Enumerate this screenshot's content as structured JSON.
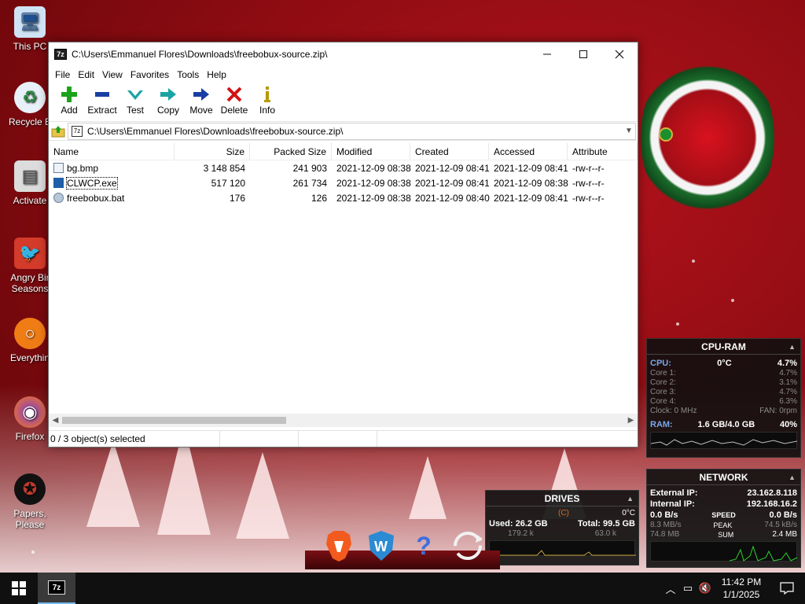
{
  "desktop": {
    "icons": [
      {
        "label": "This PC"
      },
      {
        "label": "Recycle B"
      },
      {
        "label": "Activate"
      },
      {
        "label": "Angry Bir Seasons"
      },
      {
        "label": "Everythin"
      },
      {
        "label": "Firefox"
      },
      {
        "label": "Papers, Please"
      }
    ]
  },
  "window": {
    "title": "C:\\Users\\Emmanuel Flores\\Downloads\\freebobux-source.zip\\",
    "app_icon": "7z",
    "menu": [
      "File",
      "Edit",
      "View",
      "Favorites",
      "Tools",
      "Help"
    ],
    "toolbar": [
      {
        "label": "Add",
        "icon": "plus-icon",
        "color": "#1aa31a"
      },
      {
        "label": "Extract",
        "icon": "minus-icon",
        "color": "#1a3fa3"
      },
      {
        "label": "Test",
        "icon": "check-icon",
        "color": "#1aa3a3"
      },
      {
        "label": "Copy",
        "icon": "arrow-right-icon",
        "color": "#1aa3a3"
      },
      {
        "label": "Move",
        "icon": "arrow-right-icon",
        "color": "#1a3fa3"
      },
      {
        "label": "Delete",
        "icon": "x-icon",
        "color": "#d01414"
      },
      {
        "label": "Info",
        "icon": "info-icon",
        "color": "#b59a00"
      }
    ],
    "address": "C:\\Users\\Emmanuel Flores\\Downloads\\freebobux-source.zip\\",
    "columns": [
      "Name",
      "Size",
      "Packed Size",
      "Modified",
      "Created",
      "Accessed",
      "Attribute"
    ],
    "files": [
      {
        "name": "bg.bmp",
        "size": "3 148 854",
        "packed": "241 903",
        "modified": "2021-12-09 08:38",
        "created": "2021-12-09 08:41",
        "accessed": "2021-12-09 08:41",
        "attr": "-rw-r--r-"
      },
      {
        "name": "CLWCP.exe",
        "size": "517 120",
        "packed": "261 734",
        "modified": "2021-12-09 08:38",
        "created": "2021-12-09 08:41",
        "accessed": "2021-12-09 08:38",
        "attr": "-rw-r--r-"
      },
      {
        "name": "freebobux.bat",
        "size": "176",
        "packed": "126",
        "modified": "2021-12-09 08:38",
        "created": "2021-12-09 08:40",
        "accessed": "2021-12-09 08:41",
        "attr": "-rw-r--r-"
      }
    ],
    "status": "0 / 3 object(s) selected"
  },
  "cpu_gadget": {
    "title": "CPU-RAM",
    "cpu_label": "CPU:",
    "cpu_temp": "0°C",
    "cpu_pct": "4.7%",
    "cores": [
      {
        "label": "Core 1:",
        "value": "4.7%"
      },
      {
        "label": "Core 2:",
        "value": "3.1%"
      },
      {
        "label": "Core 3:",
        "value": "4.7%"
      },
      {
        "label": "Core 4:",
        "value": "6.3%"
      }
    ],
    "clock": "Clock: 0 MHz",
    "fan": "FAN: 0rpm",
    "ram_label": "RAM:",
    "ram_value": "1.6 GB/4.0 GB",
    "ram_pct": "40%"
  },
  "network_gadget": {
    "title": "NETWORK",
    "ext_label": "External IP:",
    "ext_ip": "23.162.8.118",
    "int_label": "Internal IP:",
    "int_ip": "192.168.16.2",
    "speed_left": "0.0 B/s",
    "speed_label": "SPEED",
    "speed_right": "0.0 B/s",
    "peak_left": "8.3 MB/s",
    "peak_label": "PEAK",
    "peak_right": "74.5 kB/s",
    "sum_left": "74.8 MB",
    "sum_label": "SUM",
    "sum_right": "2.4 MB"
  },
  "drives_gadget": {
    "title": "DRIVES",
    "drive_letter": "(C)",
    "temp": "0°C",
    "used": "Used: 26.2 GB",
    "total": "Total: 99.5 GB",
    "read": "179.2 k",
    "write": "63.0 k"
  },
  "taskbar": {
    "app_icon": "7z",
    "time": "11:42 PM",
    "date": "1/1/2025"
  }
}
